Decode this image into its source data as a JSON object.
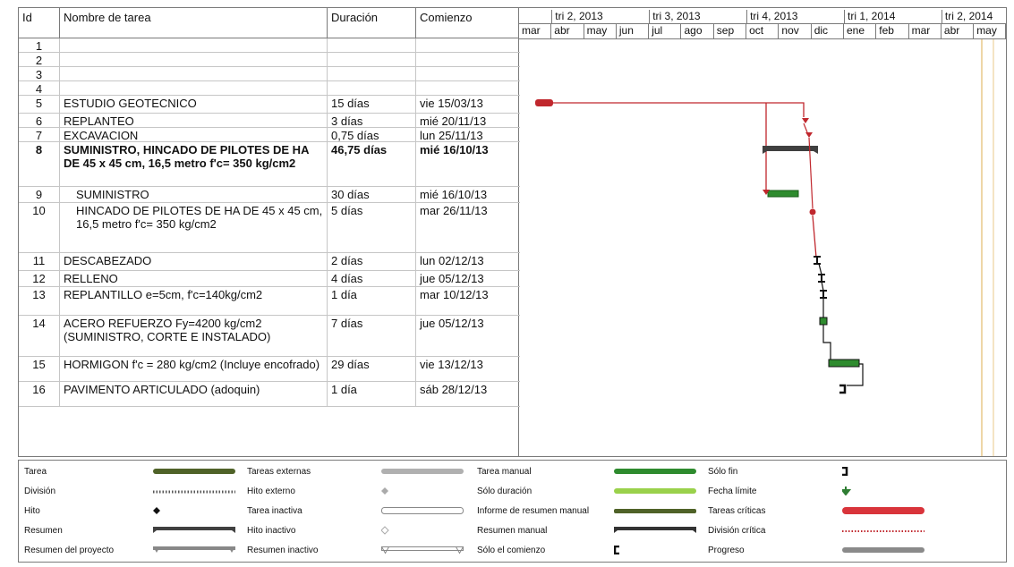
{
  "table": {
    "headers": {
      "id": "Id",
      "name": "Nombre de tarea",
      "duration": "Duración",
      "start": "Comienzo"
    },
    "rows": [
      {
        "id": "1",
        "name": "",
        "duration": "",
        "start": ""
      },
      {
        "id": "2",
        "name": "",
        "duration": "",
        "start": ""
      },
      {
        "id": "3",
        "name": "",
        "duration": "",
        "start": ""
      },
      {
        "id": "4",
        "name": "",
        "duration": "",
        "start": ""
      },
      {
        "id": "5",
        "name": "ESTUDIO GEOTECNICO",
        "duration": "15 días",
        "start": "vie 15/03/13"
      },
      {
        "id": "6",
        "name": "REPLANTEO",
        "duration": "3 días",
        "start": "mié 20/11/13"
      },
      {
        "id": "7",
        "name": "EXCAVACION",
        "duration": "0,75 días",
        "start": "lun 25/11/13"
      },
      {
        "id": "8",
        "name": "SUMINISTRO, HINCADO DE PILOTES DE HA DE 45 x 45 cm, 16,5 metro f'c= 350 kg/cm2",
        "duration": "46,75 días",
        "start": "mié 16/10/13",
        "bold": true
      },
      {
        "id": "9",
        "name": "SUMINISTRO",
        "duration": "30 días",
        "start": "mié 16/10/13",
        "indent": true
      },
      {
        "id": "10",
        "name": "HINCADO DE PILOTES DE HA DE 45 x 45 cm, 16,5 metro f'c= 350 kg/cm2",
        "duration": "5 días",
        "start": "mar 26/11/13",
        "indent": true
      },
      {
        "id": "11",
        "name": "DESCABEZADO",
        "duration": "2 días",
        "start": "lun 02/12/13"
      },
      {
        "id": "12",
        "name": "RELLENO",
        "duration": "4 días",
        "start": "jue 05/12/13"
      },
      {
        "id": "13",
        "name": "REPLANTILLO e=5cm, f'c=140kg/cm2",
        "duration": "1 día",
        "start": "mar 10/12/13"
      },
      {
        "id": "14",
        "name": "ACERO REFUERZO Fy=4200 kg/cm2 (SUMINISTRO, CORTE E INSTALADO)",
        "duration": "7 días",
        "start": "jue 05/12/13"
      },
      {
        "id": "15",
        "name": "HORMIGON f'c = 280 kg/cm2 (Incluye encofrado)",
        "duration": "29 días",
        "start": "vie 13/12/13"
      },
      {
        "id": "16",
        "name": "PAVIMENTO ARTICULADO (adoquin)",
        "duration": "1 día",
        "start": "sáb 28/12/13"
      }
    ]
  },
  "timeline": {
    "quarters": [
      "tri 2, 2013",
      "tri 3, 2013",
      "tri 4, 2013",
      "tri 1, 2014",
      "tri 2, 2014"
    ],
    "months": [
      "mar",
      "abr",
      "may",
      "jun",
      "jul",
      "ago",
      "sep",
      "oct",
      "nov",
      "dic",
      "ene",
      "feb",
      "mar",
      "abr",
      "may"
    ]
  },
  "legend": {
    "col1": [
      "Tarea",
      "División",
      "Hito",
      "Resumen",
      "Resumen del proyecto"
    ],
    "col2": [
      "Tareas externas",
      "Hito externo",
      "Tarea inactiva",
      "Hito inactivo",
      "Resumen inactivo"
    ],
    "col3": [
      "Tarea manual",
      "Sólo duración",
      "Informe de resumen manual",
      "Resumen manual",
      "Sólo el comienzo"
    ],
    "col4": [
      "Sólo fin",
      "Fecha límite",
      "Tareas críticas",
      "División crítica",
      "Progreso"
    ]
  },
  "colors": {
    "critical": "#c0272d",
    "manual_task": "#2e8b2e",
    "task": "#4f6228",
    "summary": "#404040",
    "deadline": "#2e7d32"
  }
}
